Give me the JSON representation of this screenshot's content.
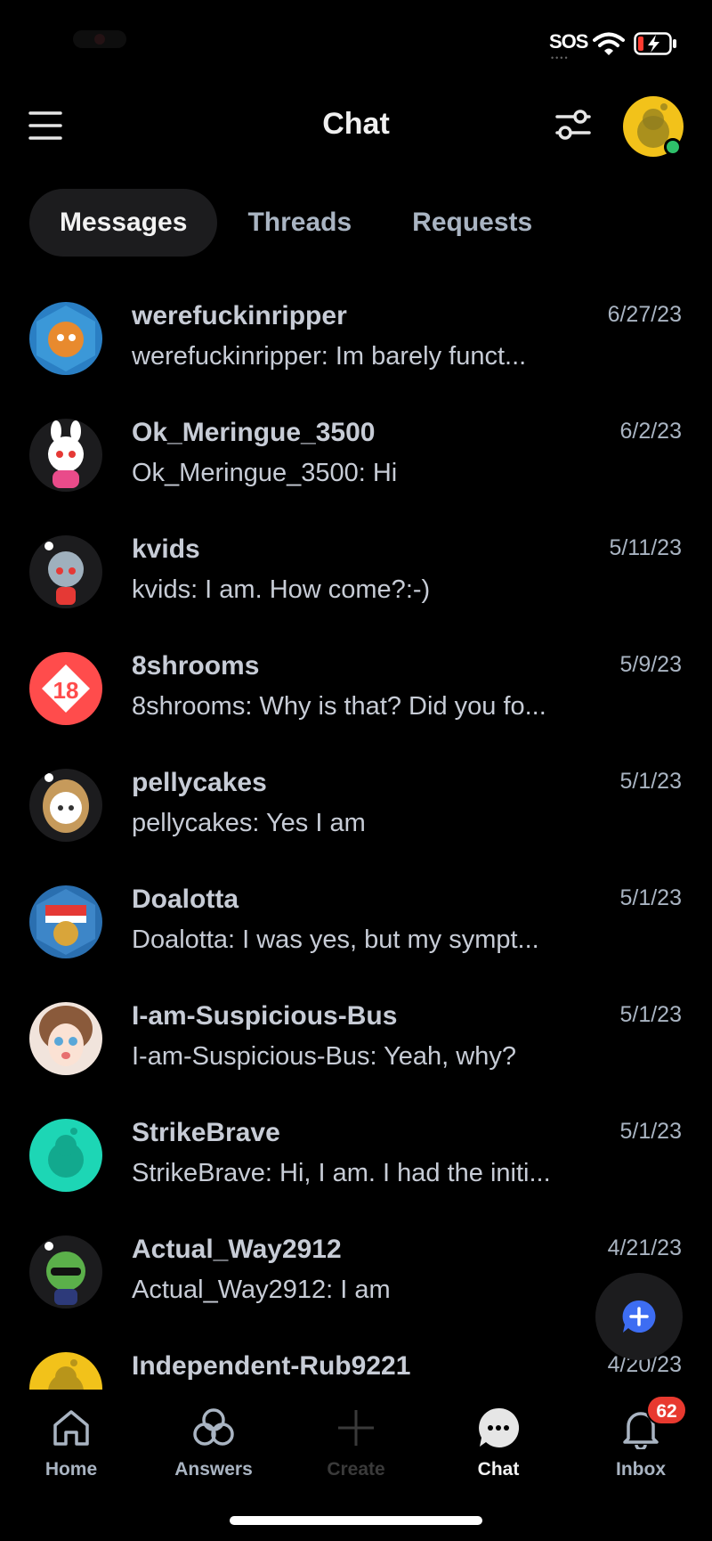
{
  "status_bar": {
    "carrier_text": "SOS",
    "icons": [
      "camera-indicator-icon",
      "wifi-icon",
      "battery-charging-icon"
    ]
  },
  "header": {
    "title": "Chat",
    "icons": [
      "menu-icon",
      "filter-icon",
      "user-avatar"
    ]
  },
  "tabs": [
    {
      "label": "Messages",
      "active": true
    },
    {
      "label": "Threads",
      "active": false
    },
    {
      "label": "Requests",
      "active": false
    }
  ],
  "conversations": [
    {
      "name": "werefuckinripper",
      "preview": "werefuckinripper: Im barely funct...",
      "date": "6/27/23",
      "avatar_color": "#2a7fc4"
    },
    {
      "name": "Ok_Meringue_3500",
      "preview": "Ok_Meringue_3500: Hi",
      "date": "6/2/23",
      "avatar_color": "#1c1c1e"
    },
    {
      "name": "kvids",
      "preview": "kvids: I am. How come?:-)",
      "date": "5/11/23",
      "avatar_color": "#1c1c1e"
    },
    {
      "name": "8shrooms",
      "preview": "8shrooms: Why is that? Did you fo...",
      "date": "5/9/23",
      "avatar_color": "#ff4c4c",
      "avatar_text": "18"
    },
    {
      "name": "pellycakes",
      "preview": "pellycakes: Yes I am",
      "date": "5/1/23",
      "avatar_color": "#1c1c1e"
    },
    {
      "name": "Doalotta",
      "preview": "Doalotta: I was yes, but my sympt...",
      "date": "5/1/23",
      "avatar_color": "#2a6fb0"
    },
    {
      "name": "I-am-Suspicious-Bus",
      "preview": "I-am-Suspicious-Bus: Yeah, why?",
      "date": "5/1/23",
      "avatar_color": "#f1e4dc"
    },
    {
      "name": "StrikeBrave",
      "preview": "StrikeBrave: Hi, I am. I had the initi...",
      "date": "5/1/23",
      "avatar_color": "#1dd6b5"
    },
    {
      "name": "Actual_Way2912",
      "preview": "Actual_Way2912: I am",
      "date": "4/21/23",
      "avatar_color": "#1c1c1e"
    },
    {
      "name": "Independent-Rub9221",
      "preview": "",
      "date": "4/20/23",
      "avatar_color": "#f2c21a"
    }
  ],
  "fab": {
    "icon": "new-chat-icon",
    "color": "#3d6df2"
  },
  "bottom_nav": [
    {
      "label": "Home",
      "icon": "home-icon"
    },
    {
      "label": "Answers",
      "icon": "answers-icon"
    },
    {
      "label": "Create",
      "icon": "plus-icon",
      "disabled": true
    },
    {
      "label": "Chat",
      "icon": "chat-bubble-icon",
      "active": true
    },
    {
      "label": "Inbox",
      "icon": "bell-icon",
      "badge": "62"
    }
  ],
  "colors": {
    "background": "#000000",
    "tab_active_bg": "#1c1c1e",
    "badge": "#e8392f",
    "online": "#2ec06a"
  }
}
